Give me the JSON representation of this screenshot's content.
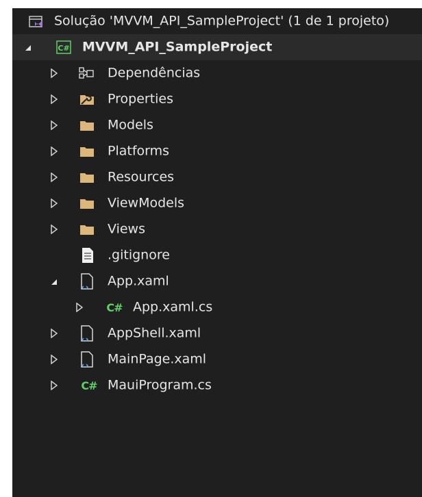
{
  "solution": {
    "title": "Solução 'MVVM_API_SampleProject' (1 de 1 projeto)",
    "icon": "solution-icon"
  },
  "project": {
    "name": "MVVM_API_SampleProject",
    "icon": "csharp-project-icon",
    "expanded": true
  },
  "items": [
    {
      "label": "Dependências",
      "icon": "dependencies-icon",
      "expander": "collapsed"
    },
    {
      "label": "Properties",
      "icon": "properties-folder-icon",
      "expander": "collapsed"
    },
    {
      "label": "Models",
      "icon": "folder-icon",
      "expander": "collapsed"
    },
    {
      "label": "Platforms",
      "icon": "folder-icon",
      "expander": "collapsed"
    },
    {
      "label": "Resources",
      "icon": "folder-icon",
      "expander": "collapsed"
    },
    {
      "label": "ViewModels",
      "icon": "folder-icon",
      "expander": "collapsed"
    },
    {
      "label": "Views",
      "icon": "folder-icon",
      "expander": "collapsed"
    },
    {
      "label": ".gitignore",
      "icon": "text-file-icon",
      "expander": "none"
    },
    {
      "label": "App.xaml",
      "icon": "xaml-file-icon",
      "expander": "expanded"
    },
    {
      "label": "App.xaml.cs",
      "icon": "csharp-file-icon",
      "expander": "collapsed"
    },
    {
      "label": "AppShell.xaml",
      "icon": "xaml-file-icon",
      "expander": "collapsed"
    },
    {
      "label": "MainPage.xaml",
      "icon": "xaml-file-icon",
      "expander": "collapsed"
    },
    {
      "label": "MauiProgram.cs",
      "icon": "csharp-file-icon",
      "expander": "collapsed"
    }
  ],
  "icon_glyphs": {
    "csharp": "C#"
  },
  "colors": {
    "background": "#1f1f1f",
    "text": "#e6e6e6",
    "folder": "#dcb67a",
    "csharp": "#5fd068",
    "selected_row": "#2b2b2b"
  }
}
